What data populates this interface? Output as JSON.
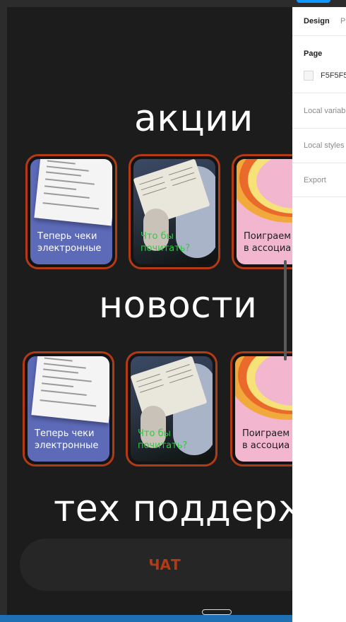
{
  "sections": {
    "promotions_title": "акции",
    "news_title": "новости",
    "support_title": "тех поддерж"
  },
  "cards": {
    "receipts": "Теперь чеки\nэлектронные",
    "reading": "Что бы\nпочитать?",
    "associations": "Поиграем\nв ассоциа"
  },
  "chat_button": "ЧАТ",
  "panel": {
    "tab_design": "Design",
    "tab_prototype": "P",
    "page_label": "Page",
    "page_color": "F5F5F5",
    "local_variables": "Local variab",
    "local_styles": "Local styles",
    "export": "Export"
  },
  "colors": {
    "card_border": "#b23a14",
    "receipt_bg": "#5c6ab8",
    "reading_text": "#2ecc40",
    "rainbow_bg": "#f3b6cf",
    "accent_blue": "#0d99ff"
  }
}
